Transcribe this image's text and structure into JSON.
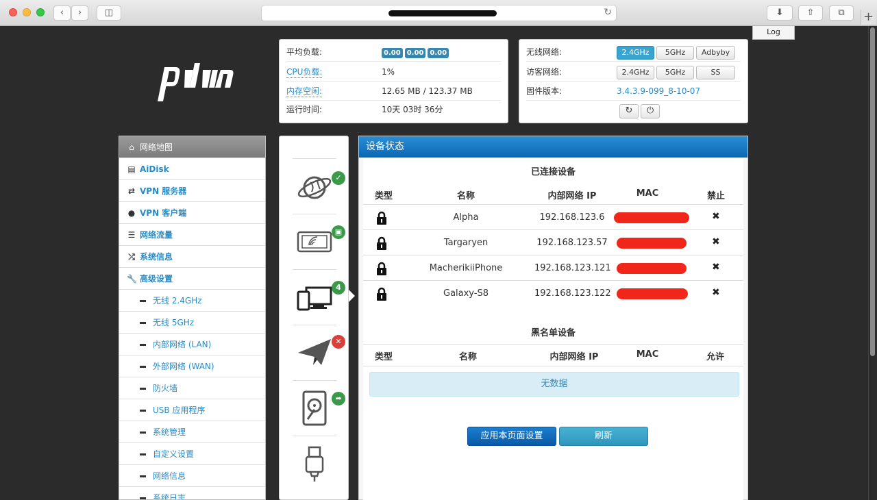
{
  "browser": {
    "log_label": "Log",
    "plus_label": "+"
  },
  "status": {
    "load_label": "平均负载:",
    "load_values": [
      "0.00",
      "0.00",
      "0.00"
    ],
    "cpu_label": "CPU负载:",
    "cpu_value": "1%",
    "mem_label": "内存空闲:",
    "mem_value": "12.65 MB / 123.37 MB",
    "uptime_label": "运行时间:",
    "uptime_value": "10天 03时 36分"
  },
  "network": {
    "wireless_label": "无线网络:",
    "wireless_buttons": [
      "2.4GHz",
      "5GHz",
      "Adbyby"
    ],
    "guest_label": "访客网络:",
    "guest_buttons": [
      "2.4GHz",
      "5GHz",
      "SS"
    ],
    "firmware_label": "固件版本:",
    "firmware_value": "3.4.3.9-099_8-10-07"
  },
  "sidebar": {
    "items": [
      {
        "label": "网络地图",
        "icon": "home-icon"
      },
      {
        "label": "AiDisk",
        "icon": "disk-icon"
      },
      {
        "label": "VPN 服务器",
        "icon": "retweet-icon"
      },
      {
        "label": "VPN 客户端",
        "icon": "globe-icon"
      },
      {
        "label": "网络流量",
        "icon": "list-icon"
      },
      {
        "label": "系统信息",
        "icon": "random-icon"
      },
      {
        "label": "高级设置",
        "icon": "wrench-icon"
      }
    ],
    "subitems": [
      "无线 2.4GHz",
      "无线 5GHz",
      "内部网络 (LAN)",
      "外部网络 (WAN)",
      "防火墙",
      "USB 应用程序",
      "系统管理",
      "自定义设置",
      "网络信息",
      "系统日志"
    ]
  },
  "iconstrip": {
    "client_count": "4"
  },
  "main": {
    "title": "设备状态",
    "connected_title": "已连接设备",
    "blacklist_title": "黑名单设备",
    "headers": {
      "type": "类型",
      "name": "名称",
      "ip": "内部网络 IP",
      "mac": "MAC",
      "block": "禁止",
      "allow": "允许"
    },
    "devices": [
      {
        "name": "Alpha",
        "ip": "192.168.123.6"
      },
      {
        "name": "Targaryen",
        "ip": "192.168.123.57"
      },
      {
        "name": "MacherikiiPhone",
        "ip": "192.168.123.121"
      },
      {
        "name": "Galaxy-S8",
        "ip": "192.168.123.122"
      }
    ],
    "empty_text": "无数据",
    "apply_label": "应用本页面设置",
    "refresh_label": "刷新"
  }
}
